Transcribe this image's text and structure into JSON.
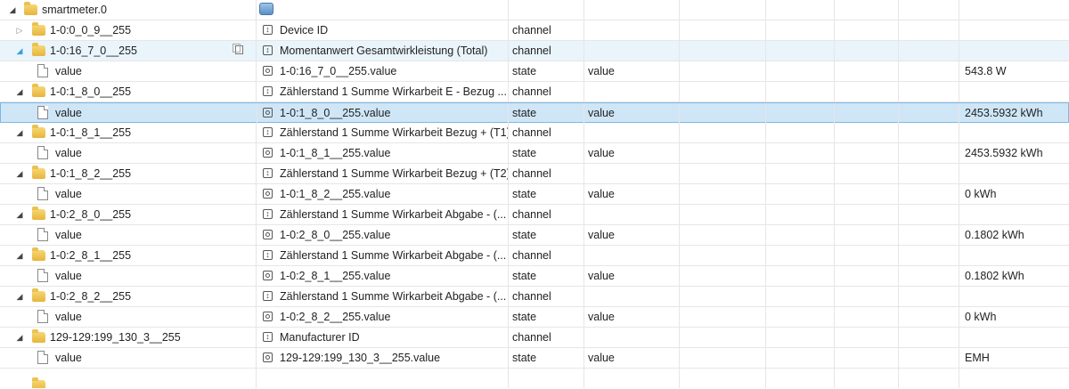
{
  "adapter": {
    "name": "smartmeter.0"
  },
  "rows": [
    {
      "name": "1-0:0_0_9__255",
      "desc": "Device ID",
      "type": "channel",
      "role": "",
      "value": ""
    },
    {
      "name": "1-0:16_7_0__255",
      "desc": "Momentanwert Gesamtwirkleistung (Total)",
      "type": "channel",
      "role": "",
      "value": ""
    },
    {
      "name": "value",
      "desc": "1-0:16_7_0__255.value",
      "type": "state",
      "role": "value",
      "value": "543.8 W"
    },
    {
      "name": "1-0:1_8_0__255",
      "desc": "Zählerstand 1 Summe Wirkarbeit E - Bezug ...",
      "type": "channel",
      "role": "",
      "value": ""
    },
    {
      "name": "value",
      "desc": "1-0:1_8_0__255.value",
      "type": "state",
      "role": "value",
      "value": "2453.5932 kWh"
    },
    {
      "name": "1-0:1_8_1__255",
      "desc": "Zählerstand 1 Summe Wirkarbeit Bezug + (T1)",
      "type": "channel",
      "role": "",
      "value": ""
    },
    {
      "name": "value",
      "desc": "1-0:1_8_1__255.value",
      "type": "state",
      "role": "value",
      "value": "2453.5932 kWh"
    },
    {
      "name": "1-0:1_8_2__255",
      "desc": "Zählerstand 1 Summe Wirkarbeit Bezug + (T2)",
      "type": "channel",
      "role": "",
      "value": ""
    },
    {
      "name": "value",
      "desc": "1-0:1_8_2__255.value",
      "type": "state",
      "role": "value",
      "value": "0 kWh"
    },
    {
      "name": "1-0:2_8_0__255",
      "desc": "Zählerstand 1 Summe Wirkarbeit Abgabe - (...",
      "type": "channel",
      "role": "",
      "value": ""
    },
    {
      "name": "value",
      "desc": "1-0:2_8_0__255.value",
      "type": "state",
      "role": "value",
      "value": "0.1802 kWh"
    },
    {
      "name": "1-0:2_8_1__255",
      "desc": "Zählerstand 1 Summe Wirkarbeit Abgabe - (...",
      "type": "channel",
      "role": "",
      "value": ""
    },
    {
      "name": "value",
      "desc": "1-0:2_8_1__255.value",
      "type": "state",
      "role": "value",
      "value": "0.1802 kWh"
    },
    {
      "name": "1-0:2_8_2__255",
      "desc": "Zählerstand 1 Summe Wirkarbeit Abgabe - (...",
      "type": "channel",
      "role": "",
      "value": ""
    },
    {
      "name": "value",
      "desc": "1-0:2_8_2__255.value",
      "type": "state",
      "role": "value",
      "value": "0 kWh"
    },
    {
      "name": "129-129:199_130_3__255",
      "desc": "Manufacturer ID",
      "type": "channel",
      "role": "",
      "value": ""
    },
    {
      "name": "value",
      "desc": "129-129:199_130_3__255.value",
      "type": "state",
      "role": "value",
      "value": "EMH"
    }
  ],
  "icons": {
    "expanded": "triangle-down-icon",
    "collapsed": "triangle-right-icon",
    "folder": "folder-icon",
    "state": "file-icon",
    "copy": "copy-icon"
  }
}
